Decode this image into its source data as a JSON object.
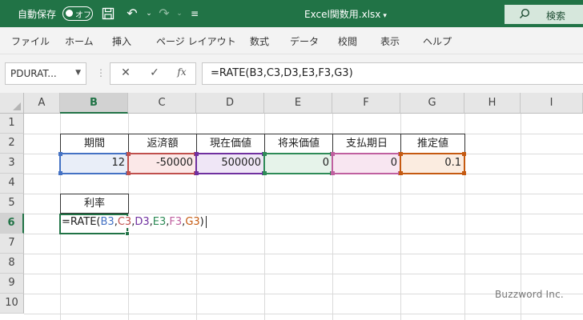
{
  "titlebar": {
    "autosave_label": "自動保存",
    "autosave_state": "オフ",
    "doc_title": "Excel関数用.xlsx",
    "search_label": "検索"
  },
  "ribbon": {
    "tabs": [
      "ファイル",
      "ホーム",
      "挿入",
      "ページ レイアウト",
      "数式",
      "データ",
      "校閲",
      "表示",
      "ヘルプ"
    ]
  },
  "formula_bar": {
    "name_box": "PDURAT...",
    "cancel_icon": "✕",
    "enter_icon": "✓",
    "fx_label": "fx",
    "formula": "=RATE(B3,C3,D3,E3,F3,G3)"
  },
  "grid": {
    "columns": [
      "A",
      "B",
      "C",
      "D",
      "E",
      "F",
      "G",
      "H",
      "I"
    ],
    "rows": [
      "1",
      "2",
      "3",
      "4",
      "5",
      "6",
      "7",
      "8",
      "9",
      "10"
    ],
    "header_row": [
      "期間",
      "返済額",
      "現在価値",
      "将来価値",
      "支払期日",
      "推定値"
    ],
    "value_row": [
      "12",
      "-50000",
      "500000",
      "0",
      "0",
      "0.1"
    ],
    "result_label": "利率",
    "edit_formula": {
      "prefix": "=RATE(",
      "args": [
        "B3",
        "C3",
        "D3",
        "E3",
        "F3",
        "G3"
      ],
      "separator": ",",
      "suffix": ")"
    }
  },
  "ref_colors": [
    "#4472c4",
    "#c0504d",
    "#7030a0",
    "#2e8b57",
    "#c060a0",
    "#c55a11"
  ],
  "ref_fill_colors": [
    "#e9eef8",
    "#fbe8e8",
    "#efe6f6",
    "#e6f3ea",
    "#f8e6f1",
    "#fbece0"
  ],
  "accent_color": "#217346",
  "watermark": "Buzzword Inc."
}
